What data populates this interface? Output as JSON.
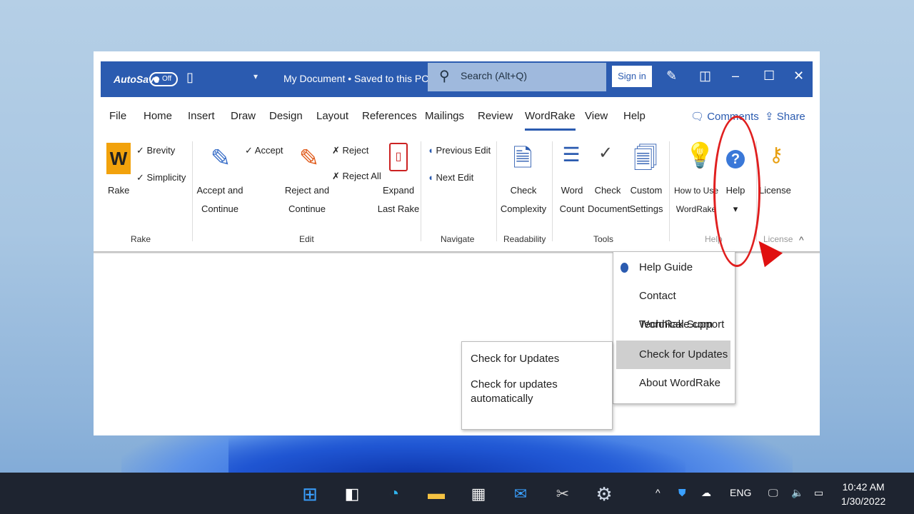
{
  "window": {
    "autosave_label": "AutoSave",
    "toggle_label": "Off",
    "doc_title": "My Document • Saved to this PC ⌄",
    "search_placeholder": "Search (Alt+Q)",
    "signin_label": "Sign in"
  },
  "tabs": [
    "File",
    "Home",
    "Insert",
    "Draw",
    "Design",
    "Layout",
    "References",
    "Mailings",
    "Review",
    "WordRake",
    "View",
    "Help"
  ],
  "active_tab": "WordRake",
  "right_actions": {
    "comments": "Comments",
    "share": "Share"
  },
  "ribbon": {
    "rake_label": "Rake",
    "options": [
      "Brevity",
      "Simplicity"
    ],
    "accept_all": [
      "Accept and",
      "Continue"
    ],
    "accept": "Accept",
    "reject_all": [
      "Reject and",
      "Continue"
    ],
    "reject": "Reject",
    "reject_all_short": "Reject All",
    "expand_rake": [
      "Expand",
      "Last Rake"
    ],
    "previous_edit": "Previous Edit",
    "next_edit": "Next Edit",
    "check_complexity": [
      "Check",
      "Complexity"
    ],
    "word_count": [
      "Word",
      "Count"
    ],
    "check_document": [
      "Check",
      "Document"
    ],
    "custom_settings": [
      "Custom",
      "Settings"
    ],
    "how_to": [
      "How to Use",
      "WordRake"
    ],
    "help": "Help",
    "license": "License",
    "groups": [
      "Rake",
      "Edit",
      "Navigate",
      "Readability",
      "Tools",
      "Help",
      "License"
    ]
  },
  "help_menu": {
    "items": [
      "Help Guide",
      "Contact WordRake.com",
      "Technical Support",
      "Check for Updates",
      "About WordRake"
    ],
    "highlighted_index": 3
  },
  "submenu": {
    "items": [
      "Check for Updates",
      "Check for updates automatically"
    ]
  },
  "taskbar": {
    "lang": "ENG",
    "time": "10:42 AM",
    "date": "1/30/2022"
  }
}
